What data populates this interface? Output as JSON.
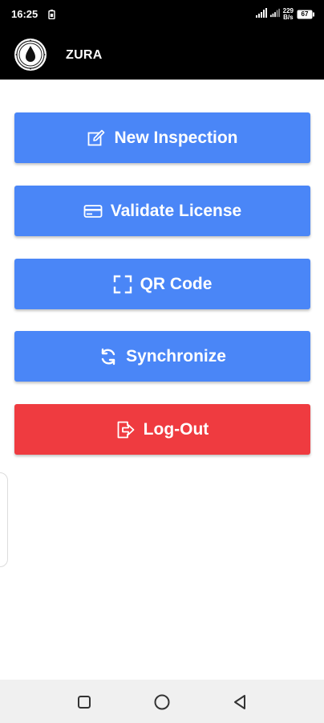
{
  "status_bar": {
    "time": "16:25",
    "net_speed_value": "229",
    "net_speed_unit": "B/s",
    "battery": "67",
    "icons": [
      "battery-saver-icon",
      "signal-icon",
      "signal-icon",
      "battery-icon"
    ]
  },
  "app_bar": {
    "title": "ZURA",
    "logo": "emblem-logo"
  },
  "menu": {
    "items": [
      {
        "label": "New Inspection",
        "icon": "edit-icon",
        "color": "#4a86f7"
      },
      {
        "label": "Validate License",
        "icon": "card-icon",
        "color": "#4a86f7"
      },
      {
        "label": "QR Code",
        "icon": "scan-icon",
        "color": "#4a86f7"
      },
      {
        "label": "Synchronize",
        "icon": "sync-icon",
        "color": "#4a86f7"
      },
      {
        "label": "Log-Out",
        "icon": "logout-icon",
        "color": "#ef3b40"
      }
    ]
  },
  "nav_bar": {
    "buttons": [
      "recent-apps-icon",
      "home-icon",
      "back-icon"
    ]
  }
}
